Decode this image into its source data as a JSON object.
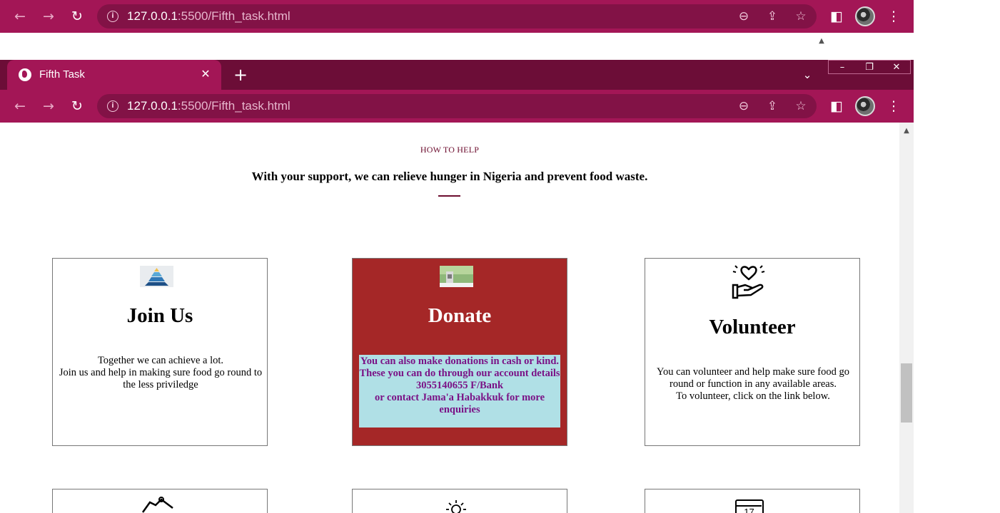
{
  "browser": {
    "url_host": "127.0.0.1",
    "url_path": ":5500/Fifth_task.html",
    "tab_title": "Fifth Task",
    "new_tab_label": "+",
    "window_controls": [
      "–",
      "❐",
      "✕"
    ]
  },
  "page": {
    "section_label": "HOW TO HELP",
    "lead": "With your support, we can relieve hunger in Nigeria and prevent food waste.",
    "cards": [
      {
        "title": "Join Us",
        "text": "Together we can achieve a lot.\nJoin us and help in making sure food go round to the less priviledge",
        "image": "pyramid-image"
      },
      {
        "title": "Donate",
        "text": "You can also make donations in cash or kind.\nThese you can do through our account details 3055140655 F/Bank\nor contact Jama'a Habakkuk for more enquiries",
        "image": "donation-photo"
      },
      {
        "title": "Volunteer",
        "text": "You can volunteer and help make sure food go round or function in any available areas.\nTo volunteer, click on the link below.",
        "image": "heart-hand-icon"
      }
    ],
    "second_row_icons": [
      "bag-icon",
      "sun-icon",
      "calendar-icon"
    ],
    "calendar_day": "17"
  },
  "colors": {
    "chrome": "#a31656",
    "tab_strip": "#6c0d37",
    "donate_card": "#a52727",
    "donate_box": "#b0e0e6",
    "donate_text": "#7a1286",
    "section_label": "#6c0d2e"
  }
}
